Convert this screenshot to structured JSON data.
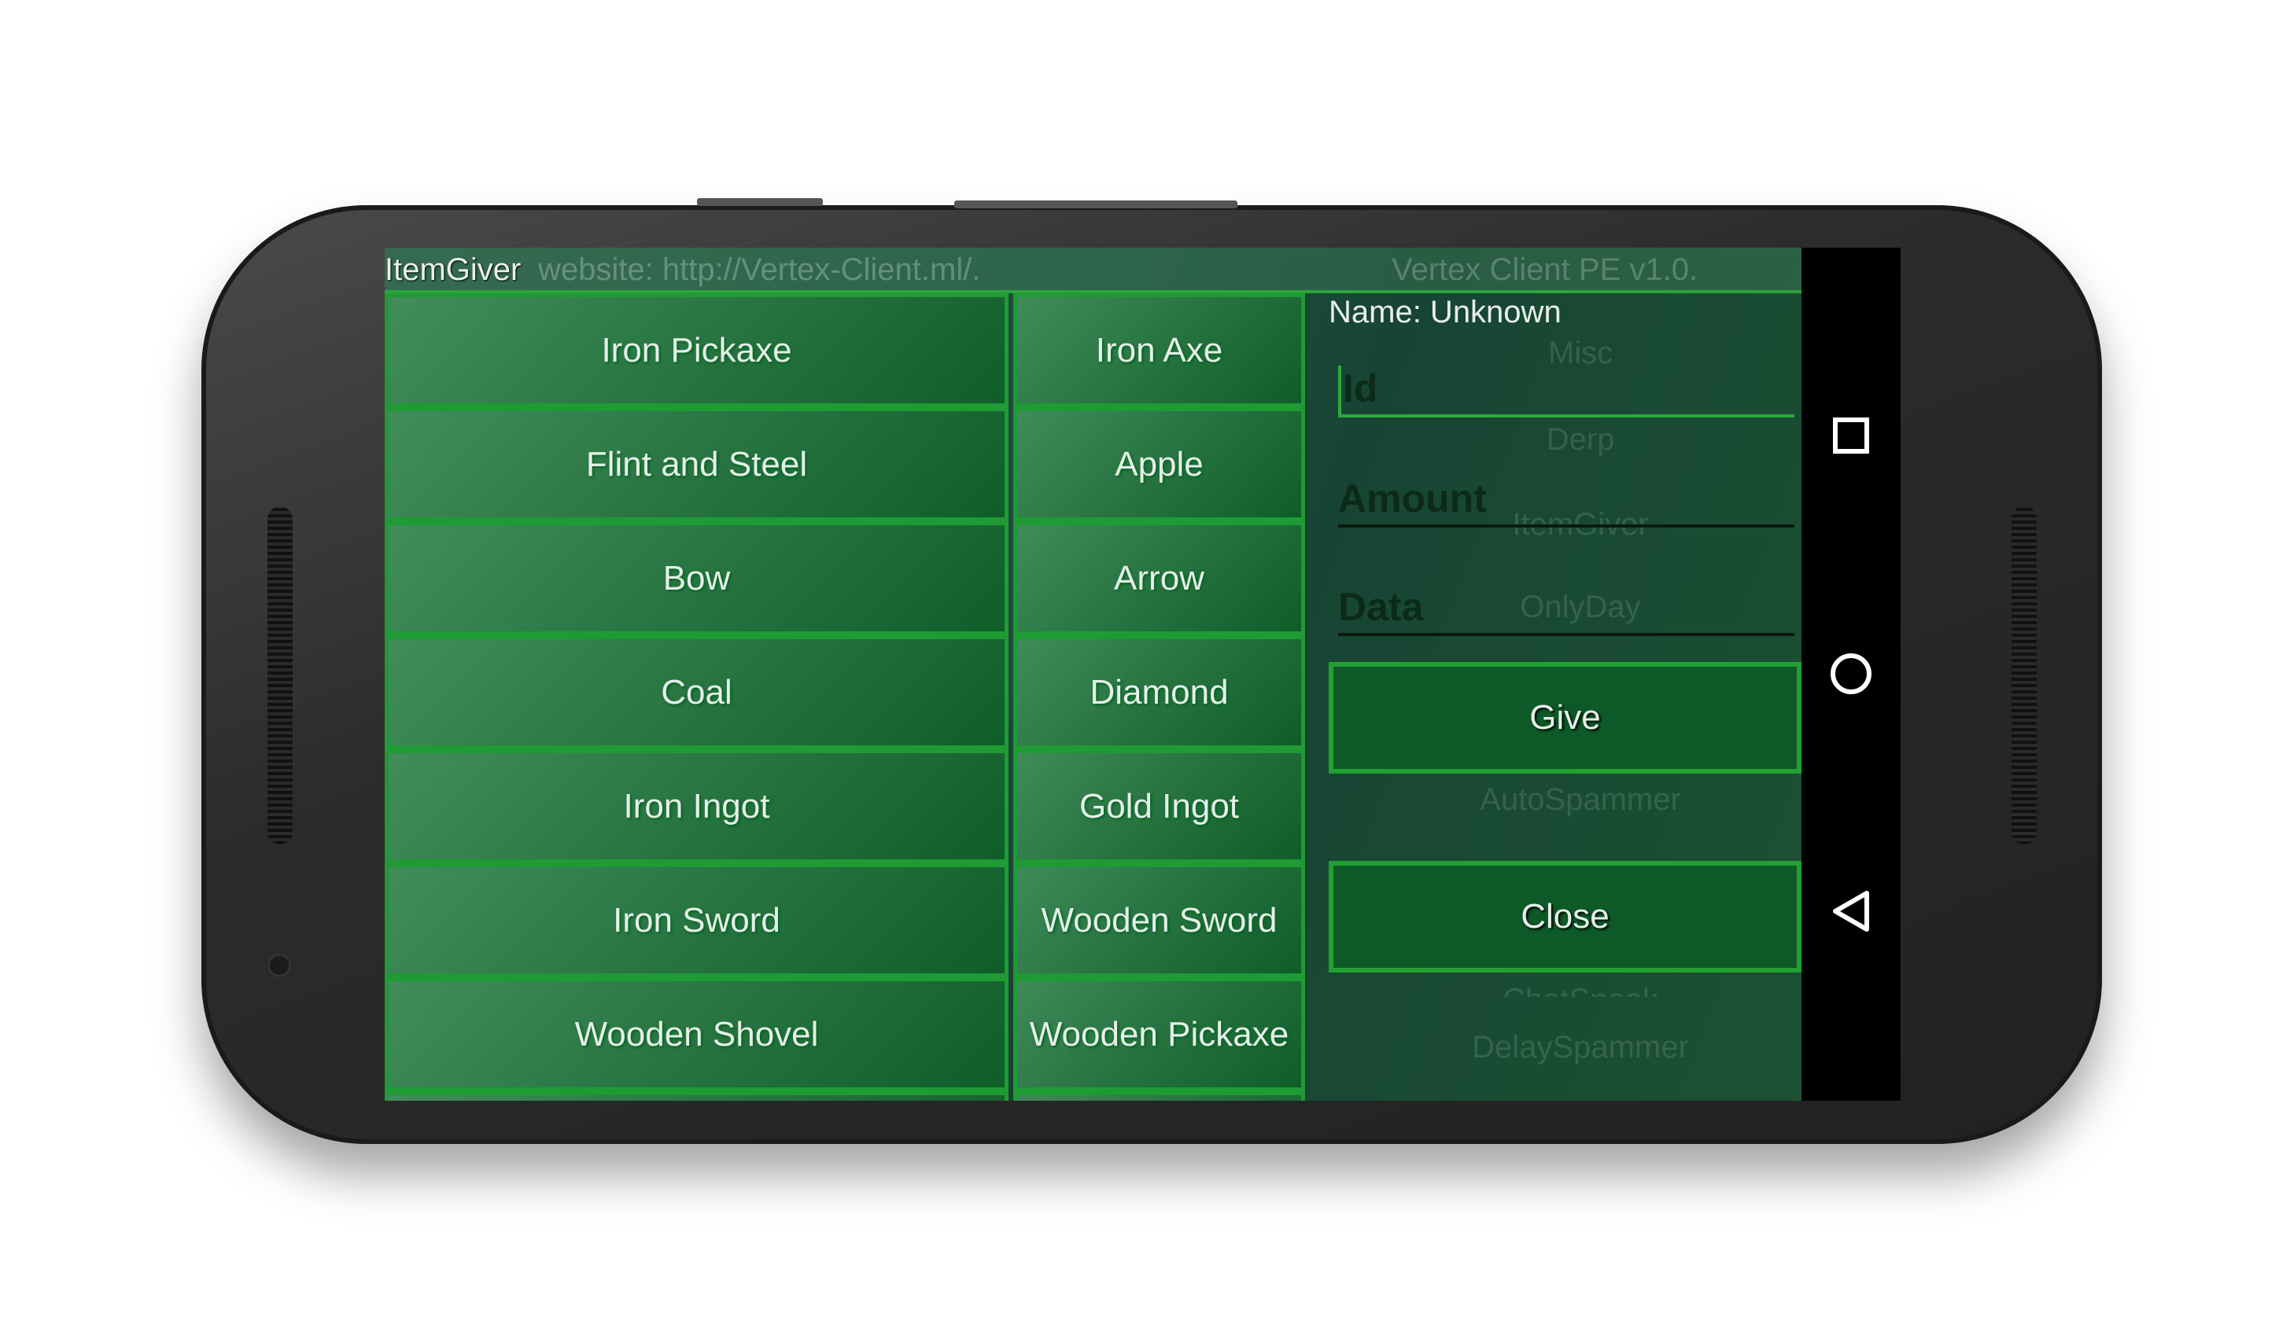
{
  "app": {
    "title": "ItemGiver",
    "background_text": "website: http://Vertex-Client.ml/.",
    "version": "Vertex Client PE v1.0."
  },
  "items": [
    [
      "Iron Pickaxe",
      "Iron Axe"
    ],
    [
      "Flint and Steel",
      "Apple"
    ],
    [
      "Bow",
      "Arrow"
    ],
    [
      "Coal",
      "Diamond"
    ],
    [
      "Iron Ingot",
      "Gold Ingot"
    ],
    [
      "Iron Sword",
      "Wooden Sword"
    ],
    [
      "Wooden Shovel",
      "Wooden Pickaxe"
    ]
  ],
  "panel": {
    "name": "Name: Unknown",
    "id_placeholder": "Id",
    "amount_placeholder": "Amount",
    "data_placeholder": "Data",
    "give": "Give",
    "close": "Close"
  },
  "background_menu": {
    "header": "Misc",
    "items": [
      "Derp",
      "ItemGiver",
      "OnlyDay",
      "AutoSpammer",
      "ChatSpeak",
      "DelaySpammer"
    ]
  },
  "colors": {
    "accent": "#1f9a35",
    "button": "#0d5a28"
  }
}
